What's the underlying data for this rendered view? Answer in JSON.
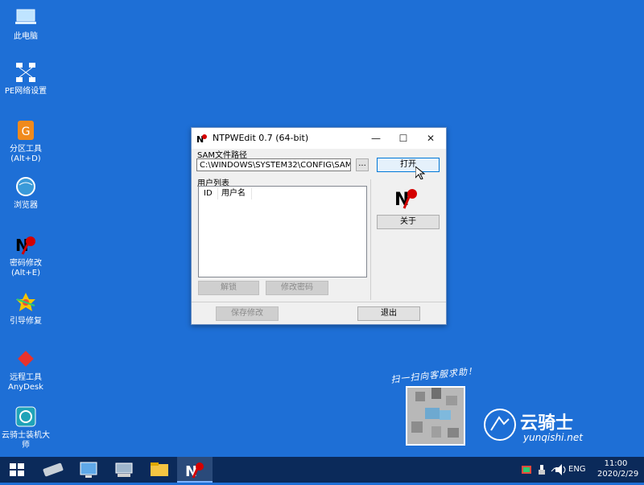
{
  "desktop": {
    "icons": [
      {
        "label": "此电脑",
        "icon": "computer-icon"
      },
      {
        "label": "PE网络设置",
        "icon": "network-icon"
      },
      {
        "label": "分区工具\n(Alt+D)",
        "label1": "分区工具",
        "label2": "(Alt+D)",
        "icon": "partition-icon"
      },
      {
        "label": "浏览器",
        "icon": "browser-icon"
      },
      {
        "label1": "密码修改",
        "label2": "(Alt+E)",
        "icon": "ntpwedit-icon"
      },
      {
        "label": "引导修复",
        "icon": "boot-repair-icon"
      },
      {
        "label1": "远程工具",
        "label2": "AnyDesk",
        "icon": "anydesk-icon"
      },
      {
        "label1": "云骑士装机大",
        "label2": "师",
        "icon": "yunqishi-icon"
      }
    ],
    "watermark": {
      "arc_text": "扫一扫向客服求助！",
      "brand_cn": "云骑士",
      "brand_url": "yunqishi.net"
    }
  },
  "window": {
    "title": "NTPWEdit 0.7 (64-bit)",
    "sam_label": "SAM文件路径",
    "sam_path": "C:\\WINDOWS\\SYSTEM32\\CONFIG\\SAM",
    "browse_label": "...",
    "open_label": "打开",
    "user_list_label": "用户列表",
    "columns": [
      "ID",
      "用户名"
    ],
    "about_label": "关于",
    "unlock_label": "解锁",
    "change_pwd_label": "修改密码",
    "save_label": "保存修改",
    "exit_label": "退出"
  },
  "taskbar": {
    "lang": "ENG",
    "time": "11:00",
    "date": "2020/2/29"
  }
}
